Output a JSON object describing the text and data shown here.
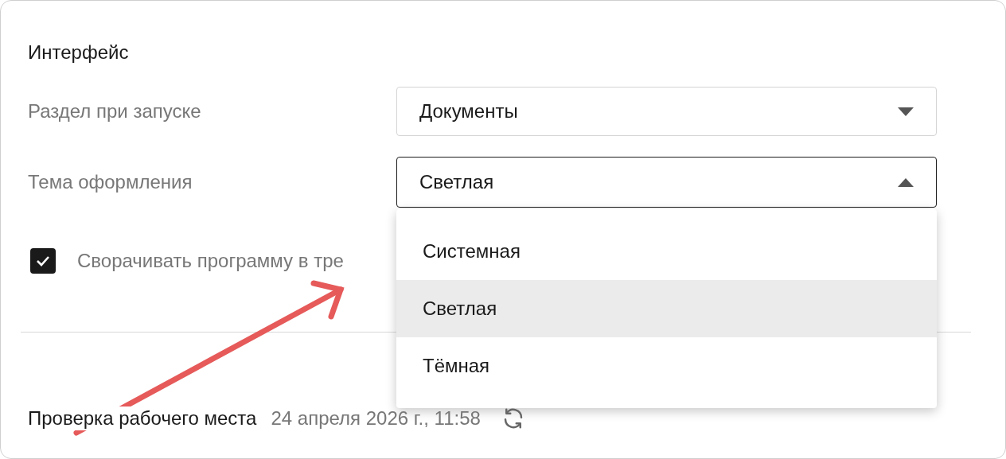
{
  "section": {
    "title": "Интерфейс"
  },
  "fields": [
    {
      "label": "Раздел при запуске",
      "value": "Документы",
      "expanded": false
    },
    {
      "label": "Тема оформления",
      "value": "Светлая",
      "expanded": true,
      "options": [
        {
          "label": "Системная",
          "selected": false
        },
        {
          "label": "Светлая",
          "selected": true
        },
        {
          "label": "Тёмная",
          "selected": false
        }
      ]
    }
  ],
  "checkbox": {
    "label": "Сворачивать программу в тре",
    "checked": true
  },
  "workplace_check": {
    "label": "Проверка рабочего места",
    "date": "24 апреля 2026 г., 11:58"
  }
}
